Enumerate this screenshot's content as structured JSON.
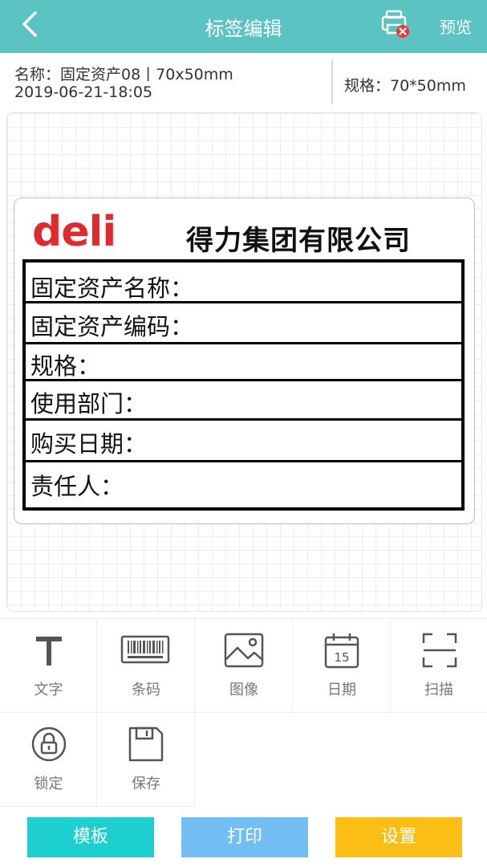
{
  "header": {
    "title": "标签编辑",
    "preview_label": "预览",
    "background": "#5bc3c1"
  },
  "info": {
    "name_line": "名称：固定资产08丨70x50mm",
    "date_line": "2019-06-21-18:05",
    "spec_line": "规格：70*50mm"
  },
  "label": {
    "logo_text": "deli",
    "logo_color": "#e02a2f",
    "company": "得力集团有限公司",
    "rows": [
      "固定资产名称：",
      "固定资产编码：",
      "规格：",
      "使用部门：",
      "购买日期：",
      "责任人："
    ]
  },
  "tools": [
    {
      "label": "文字",
      "icon": "text-icon"
    },
    {
      "label": "条码",
      "icon": "barcode-icon"
    },
    {
      "label": "图像",
      "icon": "image-icon"
    },
    {
      "label": "日期",
      "icon": "calendar-icon",
      "day": "15"
    },
    {
      "label": "扫描",
      "icon": "scan-icon"
    },
    {
      "label": "锁定",
      "icon": "lock-icon"
    },
    {
      "label": "保存",
      "icon": "save-icon"
    }
  ],
  "bottom_buttons": [
    {
      "label": "模板",
      "color": "#1ecfcf"
    },
    {
      "label": "打印",
      "color": "#73bef2"
    },
    {
      "label": "设置",
      "color": "#fbbe14"
    }
  ]
}
